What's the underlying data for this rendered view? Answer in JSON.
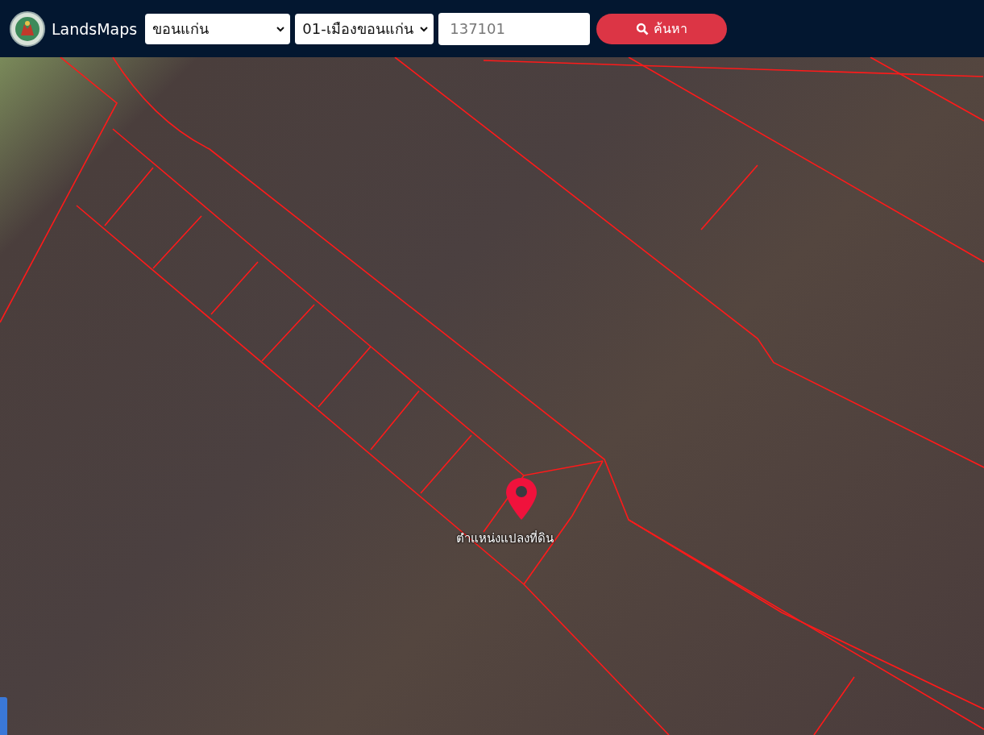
{
  "header": {
    "brand": "LandsMaps",
    "province": {
      "value": "ขอนแก่น"
    },
    "district": {
      "value": "01-เมืองขอนแก่น"
    },
    "parcel_field": {
      "placeholder": "137101"
    },
    "search_button": {
      "label": "ค้นหา"
    }
  },
  "map": {
    "marker_label": "ตำแหน่งแปลงที่ดิน"
  }
}
